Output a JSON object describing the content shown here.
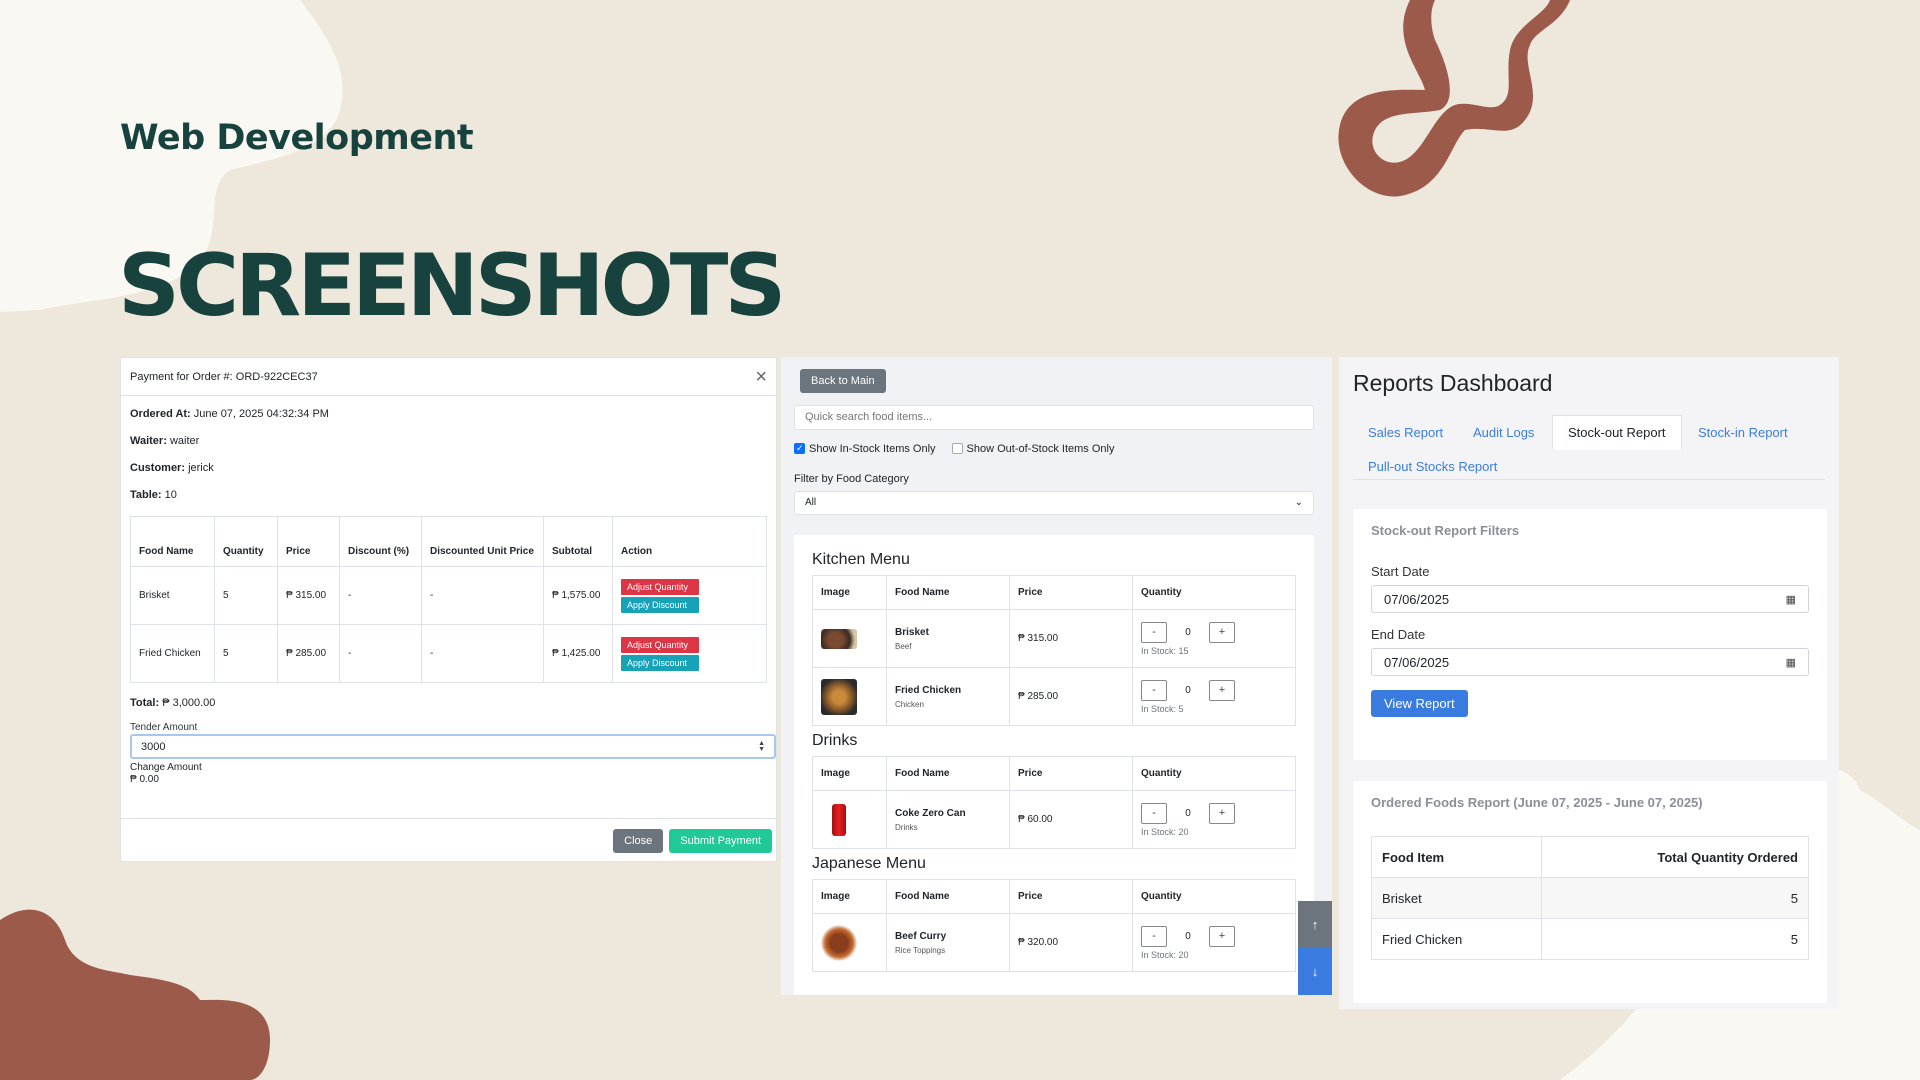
{
  "slide": {
    "sub_heading": "Web Development",
    "main_heading": "SCREENSHOTS",
    "colors": {
      "background": "#eee7db",
      "heading": "#17423d",
      "accent": "#9c5a4b",
      "cream": "#faf8f3"
    }
  },
  "payment_modal": {
    "title": "Payment for Order #: ORD-922CEC37",
    "close_icon": "close-icon",
    "ordered_at_label": "Ordered At:",
    "ordered_at": "June 07, 2025 04:32:34 PM",
    "waiter_label": "Waiter:",
    "waiter": "waiter",
    "customer_label": "Customer:",
    "customer": "jerick",
    "table_label": "Table:",
    "table": "10",
    "columns": [
      "Food Name",
      "Quantity",
      "Price",
      "Discount (%)",
      "Discounted Unit Price",
      "Subtotal",
      "Action"
    ],
    "rows": [
      {
        "food": "Brisket",
        "qty": "5",
        "price": "₱ 315.00",
        "discount": "-",
        "dup": "-",
        "subtotal": "₱ 1,575.00"
      },
      {
        "food": "Fried Chicken",
        "qty": "5",
        "price": "₱ 285.00",
        "discount": "-",
        "dup": "-",
        "subtotal": "₱ 1,425.00"
      }
    ],
    "adjust_label": "Adjust Quantity",
    "discount_label": "Apply Discount",
    "total_label": "Total:",
    "total": "₱ 3,000.00",
    "tender_label": "Tender Amount",
    "tender_value": "3000",
    "change_label": "Change Amount",
    "change_value": "₱ 0.00",
    "close_label": "Close",
    "submit_label": "Submit Payment"
  },
  "menu_panel": {
    "back_label": "Back to Main",
    "search_placeholder": "Quick search food items...",
    "in_stock_label": "Show In-Stock Items Only",
    "in_stock_checked": true,
    "out_stock_label": "Show Out-of-Stock Items Only",
    "out_stock_checked": false,
    "filter_label": "Filter by Food Category",
    "filter_value": "All",
    "columns": [
      "Image",
      "Food Name",
      "Price",
      "Quantity"
    ],
    "sections": [
      {
        "title": "Kitchen Menu",
        "items": [
          {
            "name": "Brisket",
            "category": "Beef",
            "price": "₱ 315.00",
            "qty": "0",
            "stock": "In Stock: 15"
          },
          {
            "name": "Fried Chicken",
            "category": "Chicken",
            "price": "₱ 285.00",
            "qty": "0",
            "stock": "In Stock: 5"
          }
        ]
      },
      {
        "title": "Drinks",
        "items": [
          {
            "name": "Coke Zero Can",
            "category": "Drinks",
            "price": "₱ 60.00",
            "qty": "0",
            "stock": "In Stock: 20"
          }
        ]
      },
      {
        "title": "Japanese Menu",
        "items": [
          {
            "name": "Beef Curry",
            "category": "Rice Toppings",
            "price": "₱ 320.00",
            "qty": "0",
            "stock": "In Stock: 20"
          }
        ]
      }
    ],
    "minus": "-",
    "plus": "+",
    "scroll_up_icon": "↑",
    "scroll_down_icon": "↓"
  },
  "reports": {
    "title": "Reports Dashboard",
    "tabs": [
      "Sales Report",
      "Audit Logs",
      "Stock-out Report",
      "Stock-in Report",
      "Pull-out Stocks Report"
    ],
    "active_tab": "Stock-out Report",
    "filters_title": "Stock-out Report Filters",
    "start_label": "Start Date",
    "start_value": "07/06/2025",
    "end_label": "End Date",
    "end_value": "07/06/2025",
    "view_label": "View Report",
    "result_title": "Ordered Foods Report (June 07, 2025 - June 07, 2025)",
    "columns": [
      "Food Item",
      "Total Quantity Ordered"
    ],
    "rows": [
      {
        "item": "Brisket",
        "qty": "5"
      },
      {
        "item": "Fried Chicken",
        "qty": "5"
      }
    ]
  }
}
